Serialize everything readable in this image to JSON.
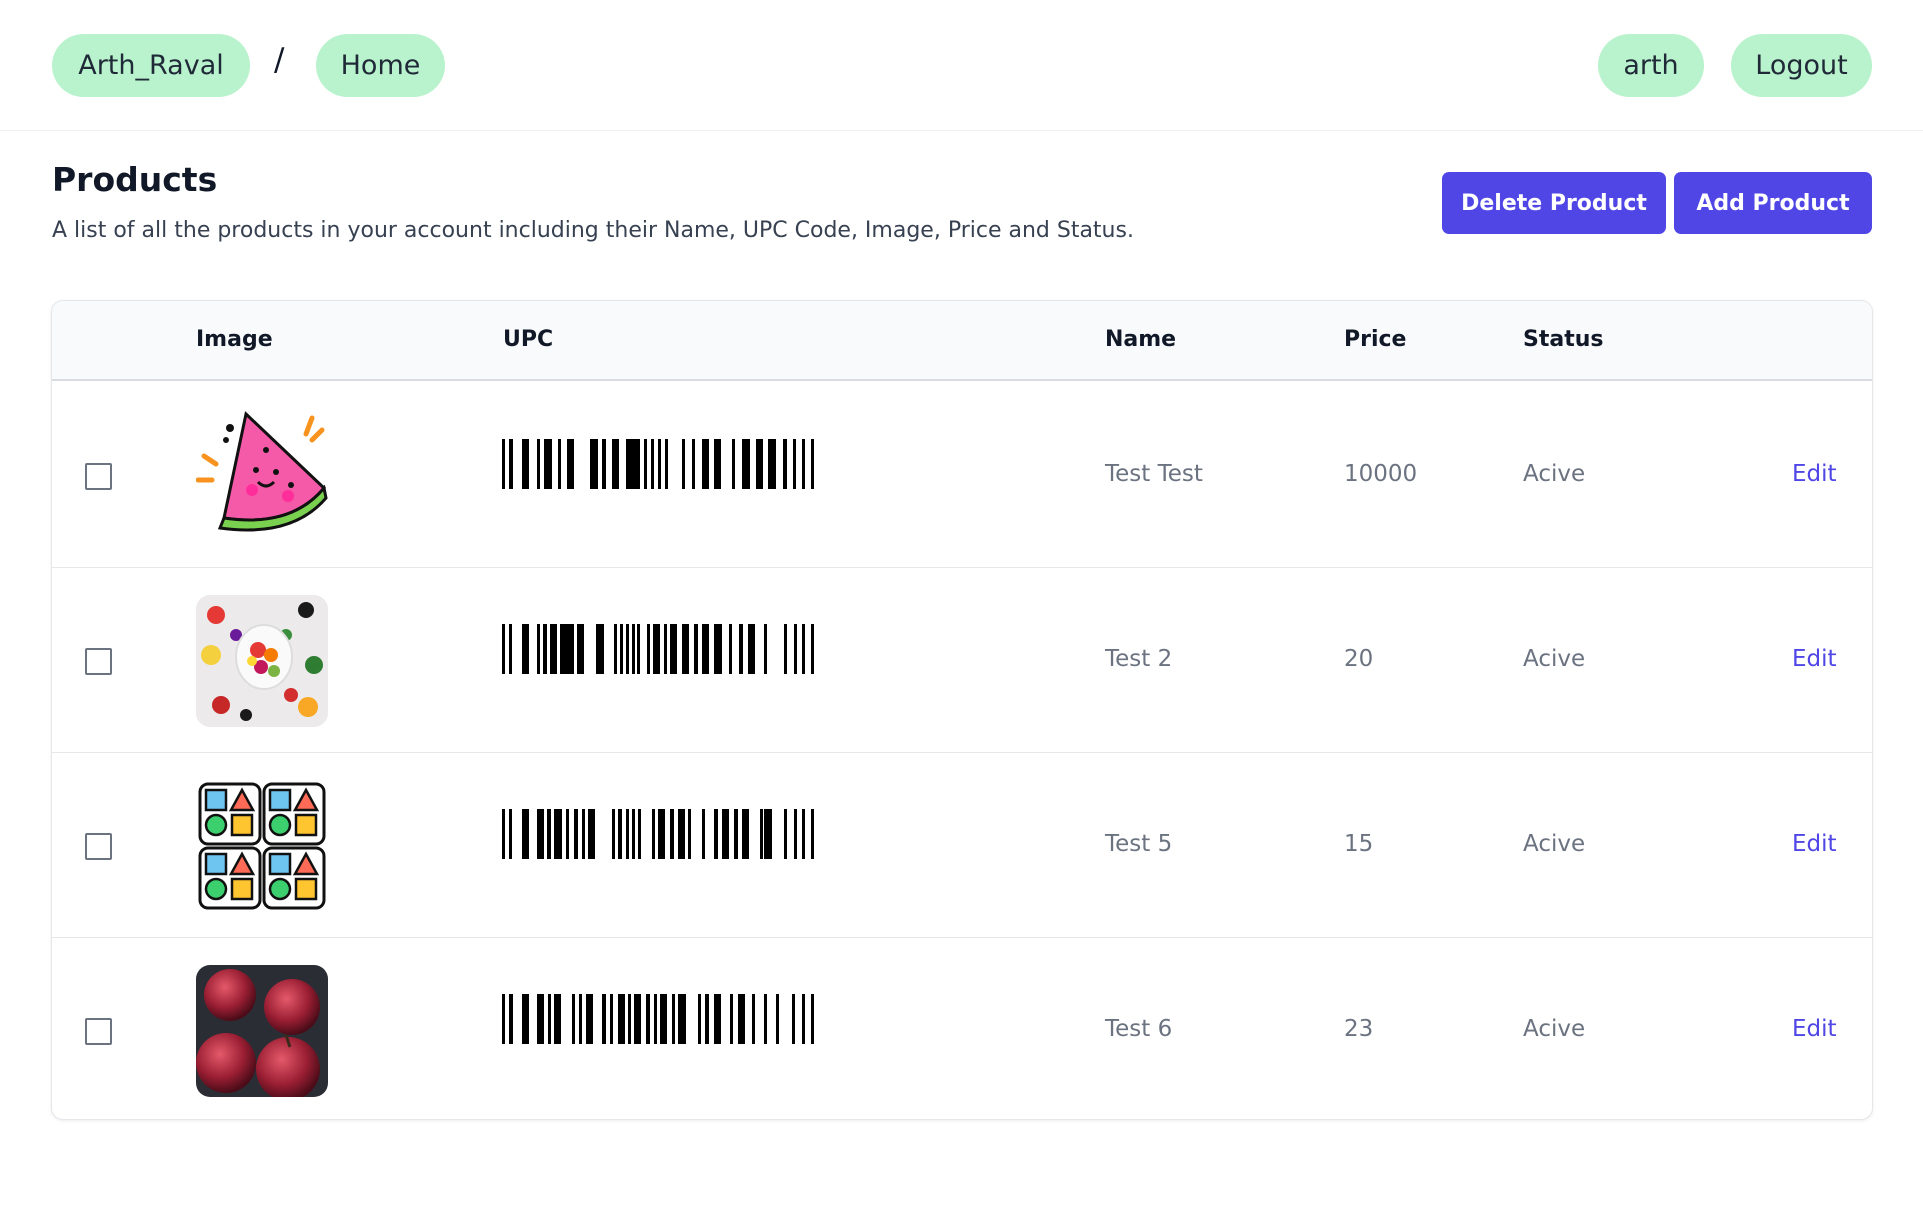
{
  "nav": {
    "breadcrumb": [
      "Arth_Raval",
      "Home"
    ],
    "separator": "/",
    "user": "arth",
    "logout_label": "Logout"
  },
  "header": {
    "title": "Products",
    "subtitle": "A list of all the products in your account including their Name, UPC Code, Image, Price and Status.",
    "delete_label": "Delete Product",
    "add_label": "Add Product"
  },
  "table": {
    "columns": [
      "Image",
      "UPC",
      "Name",
      "Price",
      "Status"
    ],
    "rows": [
      {
        "image_icon": "watermelon-image",
        "name": "Test Test",
        "price": "10000",
        "status": "Acive",
        "action": "Edit"
      },
      {
        "image_icon": "fruit-bowl-image",
        "name": "Test 2",
        "price": "20",
        "status": "Acive",
        "action": "Edit"
      },
      {
        "image_icon": "shapes-grid-image",
        "name": "Test 5",
        "price": "15",
        "status": "Acive",
        "action": "Edit"
      },
      {
        "image_icon": "red-apples-image",
        "name": "Test 6",
        "price": "23",
        "status": "Acive",
        "action": "Edit"
      }
    ]
  },
  "colors": {
    "pill": "#b9f3cd",
    "accent": "#4f46e5",
    "muted_text": "#6b7280"
  }
}
